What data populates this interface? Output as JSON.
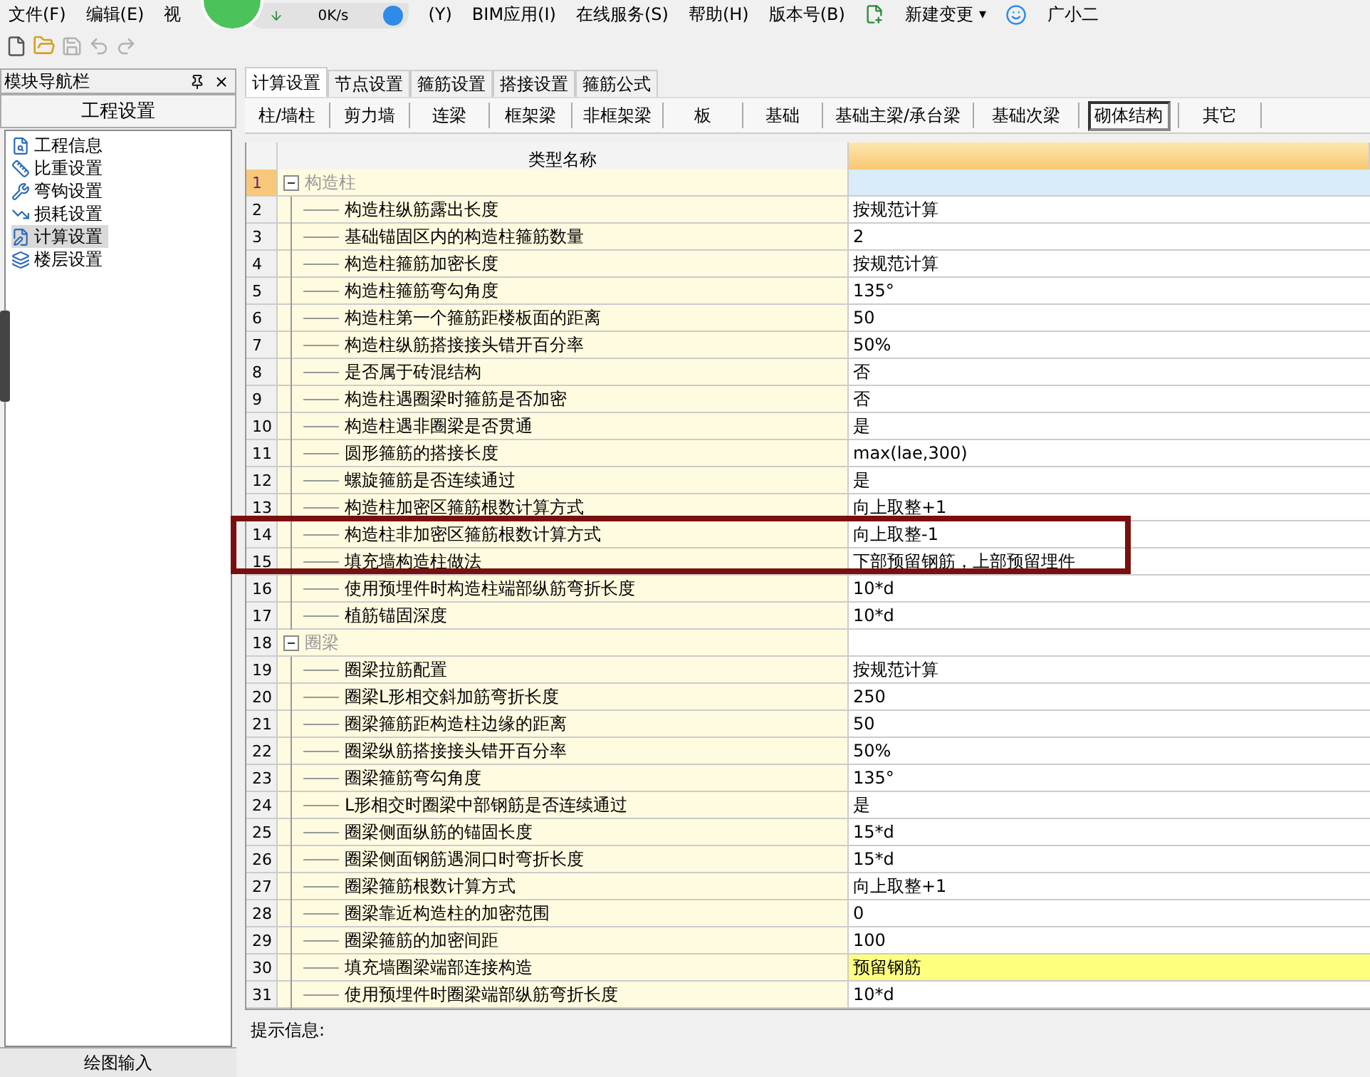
{
  "menu": [
    {
      "label": "文件(F)"
    },
    {
      "label": "编辑(E)"
    },
    {
      "label": "视"
    },
    {
      "label": "(Y)"
    },
    {
      "label": "BIM应用(I)"
    },
    {
      "label": "在线服务(S)"
    },
    {
      "label": "帮助(H)"
    },
    {
      "label": "版本号(B)"
    }
  ],
  "new_change": "新建变更",
  "new_change_caret": "▾",
  "assistant": "广小二",
  "speed_widget": {
    "reading": "0K/s"
  },
  "nav": {
    "title": "模块导航栏",
    "section": "工程设置",
    "footer": "绘图输入",
    "items": [
      {
        "label": "工程信息",
        "selected": false
      },
      {
        "label": "比重设置",
        "selected": false
      },
      {
        "label": "弯钩设置",
        "selected": false
      },
      {
        "label": "损耗设置",
        "selected": false
      },
      {
        "label": "计算设置",
        "selected": true
      },
      {
        "label": "楼层设置",
        "selected": false
      }
    ]
  },
  "tabs": [
    {
      "label": "计算设置",
      "selected": true
    },
    {
      "label": "节点设置",
      "selected": false
    },
    {
      "label": "箍筋设置",
      "selected": false
    },
    {
      "label": "搭接设置",
      "selected": false
    },
    {
      "label": "箍筋公式",
      "selected": false
    }
  ],
  "subtabs": [
    {
      "label": "柱/墙柱",
      "selected": false
    },
    {
      "label": "剪力墙",
      "selected": false
    },
    {
      "label": "连梁",
      "selected": false
    },
    {
      "label": "框架梁",
      "selected": false
    },
    {
      "label": "非框架梁",
      "selected": false
    },
    {
      "label": "板",
      "selected": false
    },
    {
      "label": "基础",
      "selected": false
    },
    {
      "label": "基础主梁/承台梁",
      "selected": false
    },
    {
      "label": "基础次梁",
      "selected": false
    },
    {
      "label": "砌体结构",
      "selected": true
    },
    {
      "label": "其它",
      "selected": false
    }
  ],
  "table": {
    "columns": [
      "类型名称"
    ],
    "groups": [
      {
        "number": "1",
        "label": "构造柱",
        "expanded": true,
        "selected": true,
        "children": [
          {
            "number": "2",
            "label": "构造柱纵筋露出长度",
            "value": "按规范计算",
            "highlighted": false
          },
          {
            "number": "3",
            "label": "基础锚固区内的构造柱箍筋数量",
            "value": "2",
            "highlighted": false
          },
          {
            "number": "4",
            "label": "构造柱箍筋加密长度",
            "value": "按规范计算",
            "highlighted": false
          },
          {
            "number": "5",
            "label": "构造柱箍筋弯勾角度",
            "value": "135°",
            "highlighted": false
          },
          {
            "number": "6",
            "label": "构造柱第一个箍筋距楼板面的距离",
            "value": "50",
            "highlighted": false
          },
          {
            "number": "7",
            "label": "构造柱纵筋搭接接头错开百分率",
            "value": "50%",
            "highlighted": false
          },
          {
            "number": "8",
            "label": "是否属于砖混结构",
            "value": "否",
            "highlighted": false
          },
          {
            "number": "9",
            "label": "构造柱遇圈梁时箍筋是否加密",
            "value": "否",
            "highlighted": false
          },
          {
            "number": "10",
            "label": "构造柱遇非圈梁是否贯通",
            "value": "是",
            "highlighted": false
          },
          {
            "number": "11",
            "label": "圆形箍筋的搭接长度",
            "value": "max(lae,300)",
            "highlighted": false
          },
          {
            "number": "12",
            "label": "螺旋箍筋是否连续通过",
            "value": "是",
            "highlighted": false
          },
          {
            "number": "13",
            "label": "构造柱加密区箍筋根数计算方式",
            "value": "向上取整+1",
            "highlighted": false
          },
          {
            "number": "14",
            "label": "构造柱非加密区箍筋根数计算方式",
            "value": "向上取整-1",
            "highlighted": false
          },
          {
            "number": "15",
            "label": "填充墙构造柱做法",
            "value": "下部预留钢筋，上部预留埋件",
            "highlighted": false
          },
          {
            "number": "16",
            "label": "使用预埋件时构造柱端部纵筋弯折长度",
            "value": "10*d",
            "highlighted": false
          },
          {
            "number": "17",
            "label": "植筋锚固深度",
            "value": "10*d",
            "highlighted": false
          }
        ]
      },
      {
        "number": "18",
        "label": "圈梁",
        "expanded": true,
        "selected": false,
        "children": [
          {
            "number": "19",
            "label": "圈梁拉筋配置",
            "value": "按规范计算",
            "highlighted": false
          },
          {
            "number": "20",
            "label": "圈梁L形相交斜加筋弯折长度",
            "value": "250",
            "highlighted": false
          },
          {
            "number": "21",
            "label": "圈梁箍筋距构造柱边缘的距离",
            "value": "50",
            "highlighted": false
          },
          {
            "number": "22",
            "label": "圈梁纵筋搭接接头错开百分率",
            "value": "50%",
            "highlighted": false
          },
          {
            "number": "23",
            "label": "圈梁箍筋弯勾角度",
            "value": "135°",
            "highlighted": false
          },
          {
            "number": "24",
            "label": "L形相交时圈梁中部钢筋是否连续通过",
            "value": "是",
            "highlighted": false
          },
          {
            "number": "25",
            "label": "圈梁侧面纵筋的锚固长度",
            "value": "15*d",
            "highlighted": false
          },
          {
            "number": "26",
            "label": "圈梁侧面钢筋遇洞口时弯折长度",
            "value": "15*d",
            "highlighted": false
          },
          {
            "number": "27",
            "label": "圈梁箍筋根数计算方式",
            "value": "向上取整+1",
            "highlighted": false
          },
          {
            "number": "28",
            "label": "圈梁靠近构造柱的加密范围",
            "value": "0",
            "highlighted": false
          },
          {
            "number": "29",
            "label": "圈梁箍筋的加密间距",
            "value": "100",
            "highlighted": false
          },
          {
            "number": "30",
            "label": "填充墙圈梁端部连接构造",
            "value": "预留钢筋",
            "highlighted": true
          },
          {
            "number": "31",
            "label": "使用预埋件时圈梁端部纵筋弯折长度",
            "value": "10*d",
            "highlighted": false
          }
        ]
      }
    ]
  },
  "hint_label": "提示信息:"
}
